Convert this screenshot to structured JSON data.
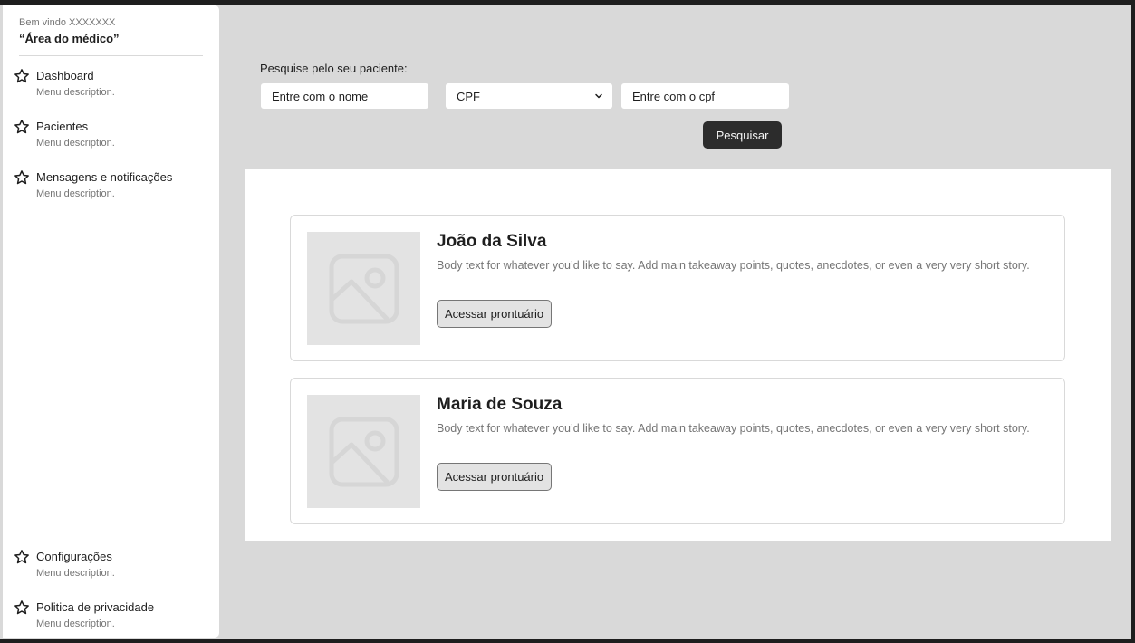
{
  "sidebar": {
    "welcome": "Bem vindo XXXXXXX",
    "title": "“Área do médico”",
    "items": [
      {
        "label": "Dashboard",
        "description": "Menu description.",
        "icon": "star-icon"
      },
      {
        "label": "Pacientes",
        "description": "Menu description.",
        "icon": "star-icon"
      },
      {
        "label": "Mensagens e notificações",
        "description": "Menu description.",
        "icon": "star-icon"
      }
    ],
    "bottom_items": [
      {
        "label": "Configurações",
        "description": "Menu description.",
        "icon": "star-icon"
      },
      {
        "label": "Politica de privacidade",
        "description": "Menu description.",
        "icon": "star-icon"
      }
    ]
  },
  "search": {
    "label": "Pesquise pelo seu paciente:",
    "name_placeholder": "Entre com o nome",
    "type_select_value": "CPF",
    "cpf_placeholder": "Entre com o cpf",
    "button_label": "Pesquisar"
  },
  "results": [
    {
      "name": "João da Silva",
      "body": "Body text for whatever you’d like to say. Add main takeaway points, quotes, anecdotes, or even a very very short story.",
      "button_label": "Acessar prontuário"
    },
    {
      "name": "Maria de Souza",
      "body": "Body text for whatever you’d like to say. Add main takeaway points, quotes, anecdotes, or even a very very short story.",
      "button_label": "Acessar prontuário"
    }
  ],
  "colors": {
    "background": "#d9d9d9",
    "surface": "#ffffff",
    "primary_button": "#2c2c2c",
    "secondary_text": "#757575",
    "placeholder_image": "#e3e3e3"
  }
}
